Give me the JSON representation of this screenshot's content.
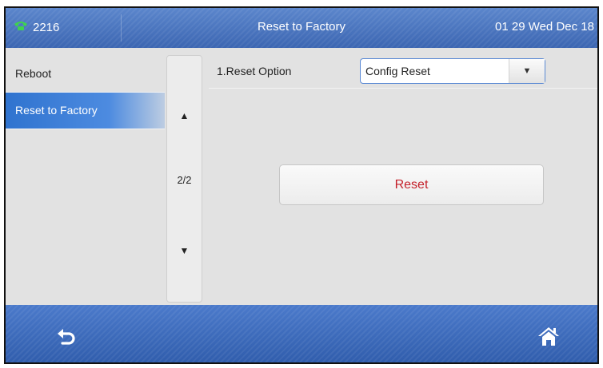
{
  "topbar": {
    "line": "2216",
    "title": "Reset to Factory",
    "datetime": "01 29 Wed Dec 18"
  },
  "menu": {
    "items": [
      {
        "label": "Reboot",
        "active": false
      },
      {
        "label": "Reset to Factory",
        "active": true
      }
    ]
  },
  "pager": {
    "up_icon": "▲",
    "page": "2/2",
    "down_icon": "▼"
  },
  "option": {
    "label": "1.Reset Option",
    "value": "Config Reset",
    "arrow_icon": "▼"
  },
  "reset_button": {
    "label": "Reset"
  },
  "bottom": {
    "back_icon": "back-icon",
    "home_icon": "home-icon"
  },
  "colors": {
    "bar_blue": "#3c66b2",
    "active_blue": "#2f73cf",
    "reset_red": "#c4202a"
  }
}
